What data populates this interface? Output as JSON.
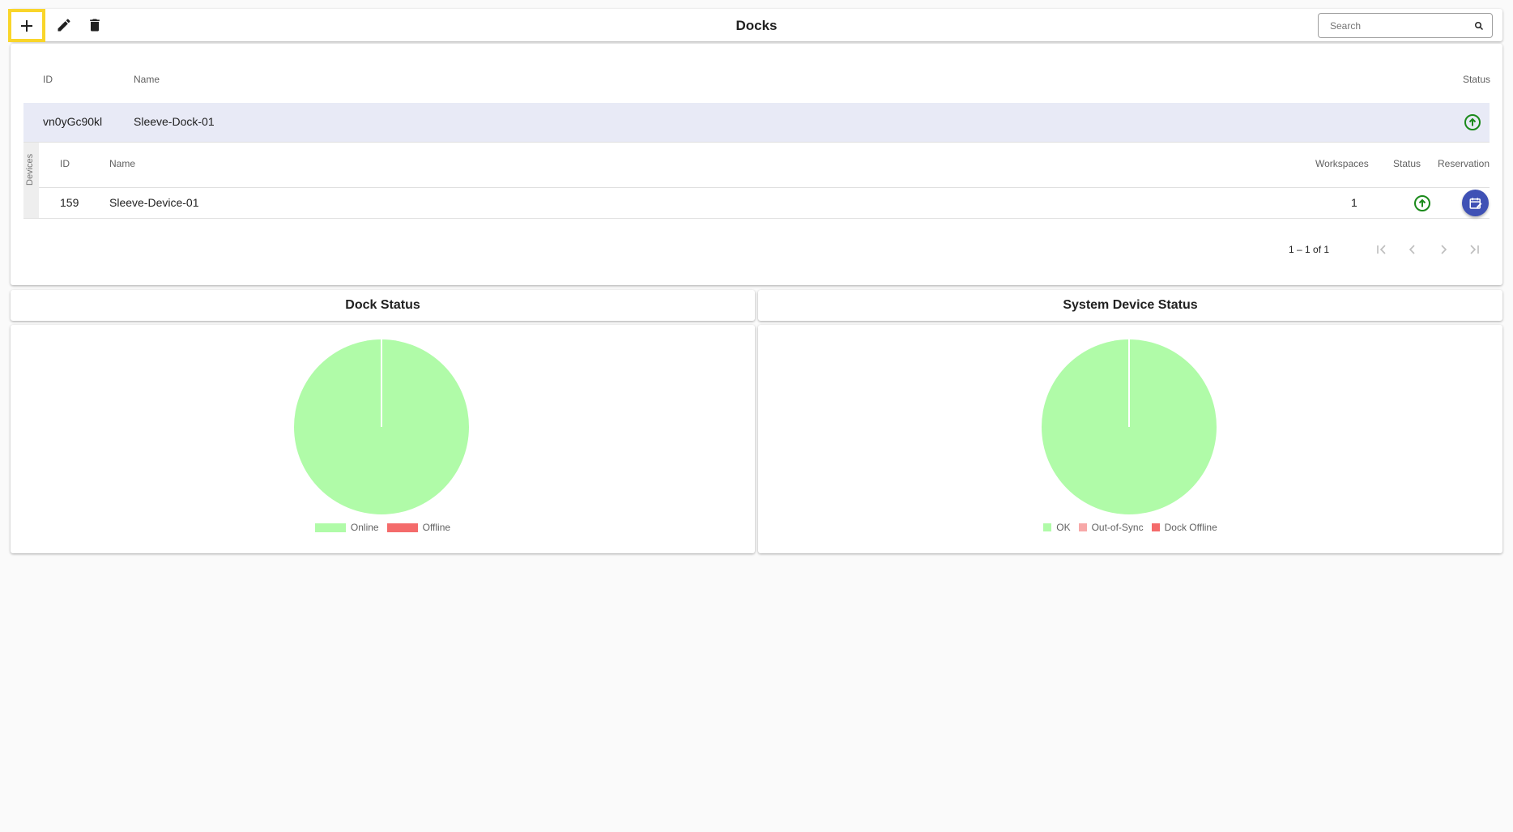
{
  "toolbar": {
    "title": "Docks",
    "search_placeholder": "Search"
  },
  "docks_table": {
    "columns": {
      "id": "ID",
      "name": "Name",
      "status": "Status"
    },
    "rows": [
      {
        "id": "vn0yGc90kl",
        "name": "Sleeve-Dock-01",
        "status": "online"
      }
    ]
  },
  "devices": {
    "label": "Devices",
    "columns": {
      "id": "ID",
      "name": "Name",
      "workspaces": "Workspaces",
      "status": "Status",
      "reservation": "Reservation"
    },
    "rows": [
      {
        "id": "159",
        "name": "Sleeve-Device-01",
        "workspaces": "1",
        "status": "online"
      }
    ]
  },
  "pagination": {
    "range_text": "1 – 1 of 1"
  },
  "colors": {
    "accent": "#3f51b5",
    "online_green": "#1b8a1b",
    "highlight": "#f9d52a",
    "row_selected": "#e8eaf6",
    "pie_ok": "#b0fba8",
    "offline_red": "#f46b6b",
    "out_of_sync": "#f7a8a8"
  },
  "charts": {
    "dock_status_title": "Dock Status",
    "system_device_status_title": "System Device Status"
  },
  "chart_data": [
    {
      "type": "pie",
      "title": "Dock Status",
      "categories": [
        "Online",
        "Offline"
      ],
      "values": [
        1,
        0
      ],
      "colors": [
        "#b0fba8",
        "#f46b6b"
      ],
      "legend": "bottom"
    },
    {
      "type": "pie",
      "title": "System Device Status",
      "categories": [
        "OK",
        "Out-of-Sync",
        "Dock Offline"
      ],
      "values": [
        1,
        0,
        0
      ],
      "colors": [
        "#b0fba8",
        "#f7a8a8",
        "#f46b6b"
      ],
      "legend": "bottom"
    }
  ]
}
